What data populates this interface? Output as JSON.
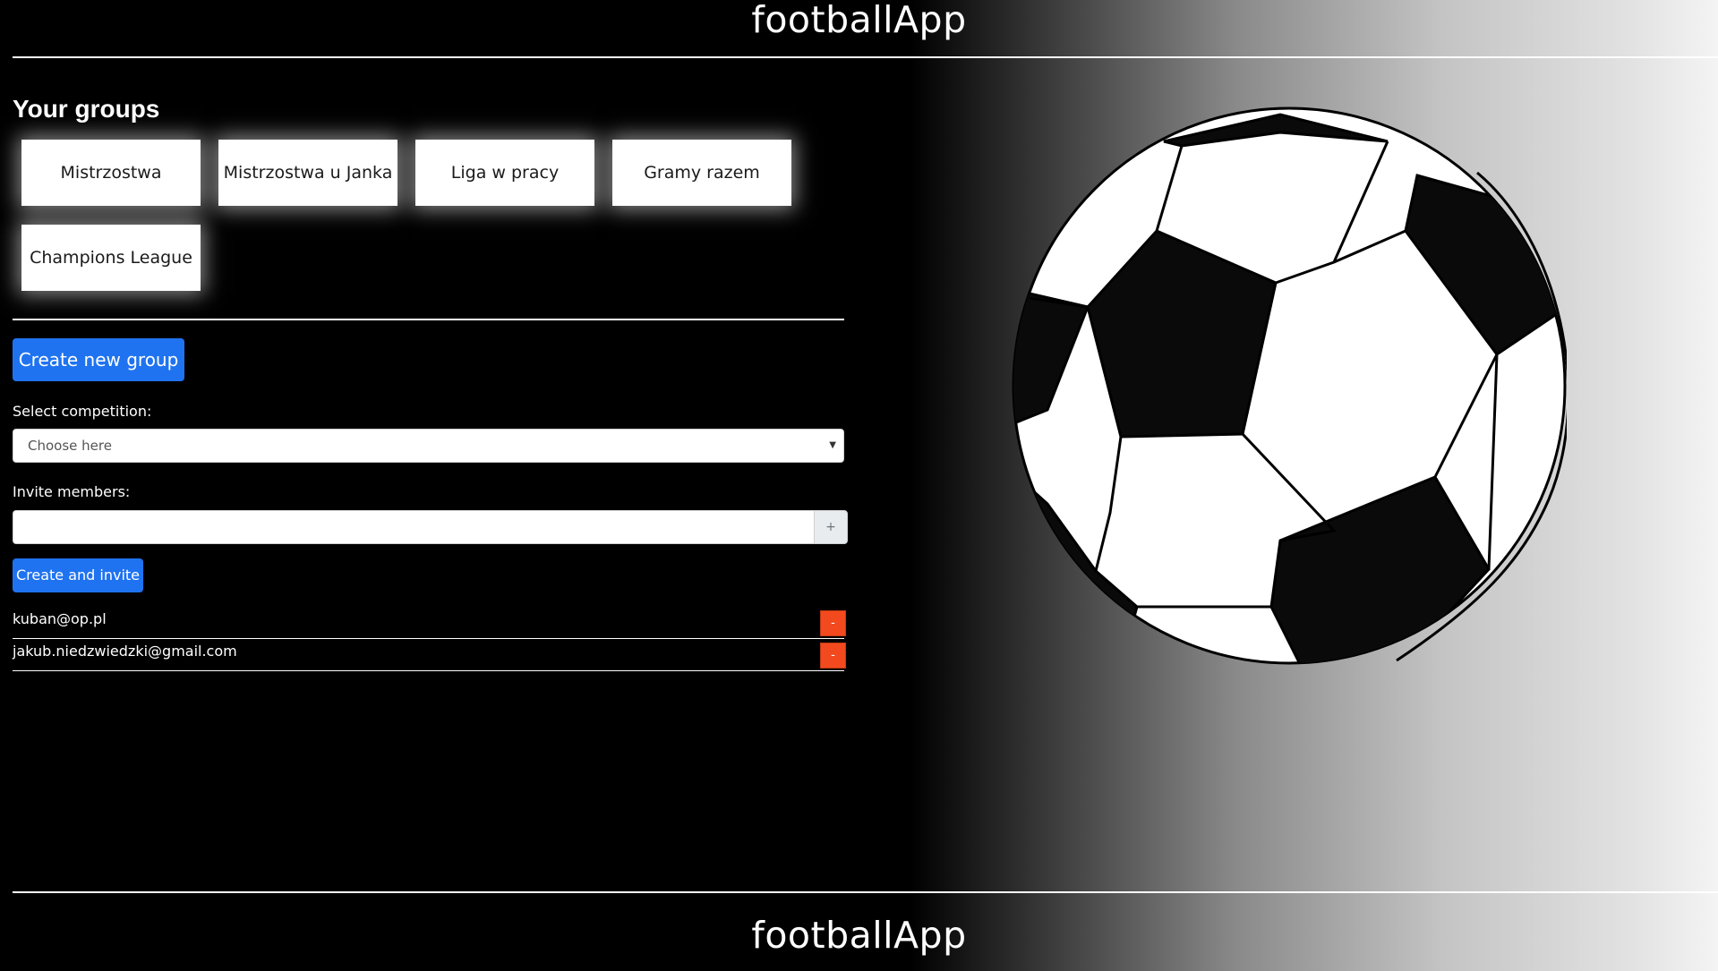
{
  "app": {
    "title": "footballApp",
    "footer_title": "footballApp"
  },
  "groups": {
    "title": "Your groups",
    "items": [
      {
        "label": "Mistrzostwa"
      },
      {
        "label": "Mistrzostwa u Janka"
      },
      {
        "label": "Liga w pracy"
      },
      {
        "label": "Gramy razem"
      },
      {
        "label": "Champions League"
      }
    ]
  },
  "create": {
    "button_label": "Create new group",
    "competition_label": "Select competition:",
    "competition_placeholder": "Choose here",
    "invite_label": "Invite members:",
    "invite_value": "",
    "add_label": "+",
    "submit_label": "Create and invite"
  },
  "members": [
    {
      "email": "kuban@op.pl",
      "remove_label": "-"
    },
    {
      "email": "jakub.niedzwiedzki@gmail.com",
      "remove_label": "-"
    }
  ],
  "colors": {
    "primary": "#1f73f0",
    "danger": "#f24a1e"
  },
  "icons": {
    "hero": "soccer-ball-icon"
  }
}
